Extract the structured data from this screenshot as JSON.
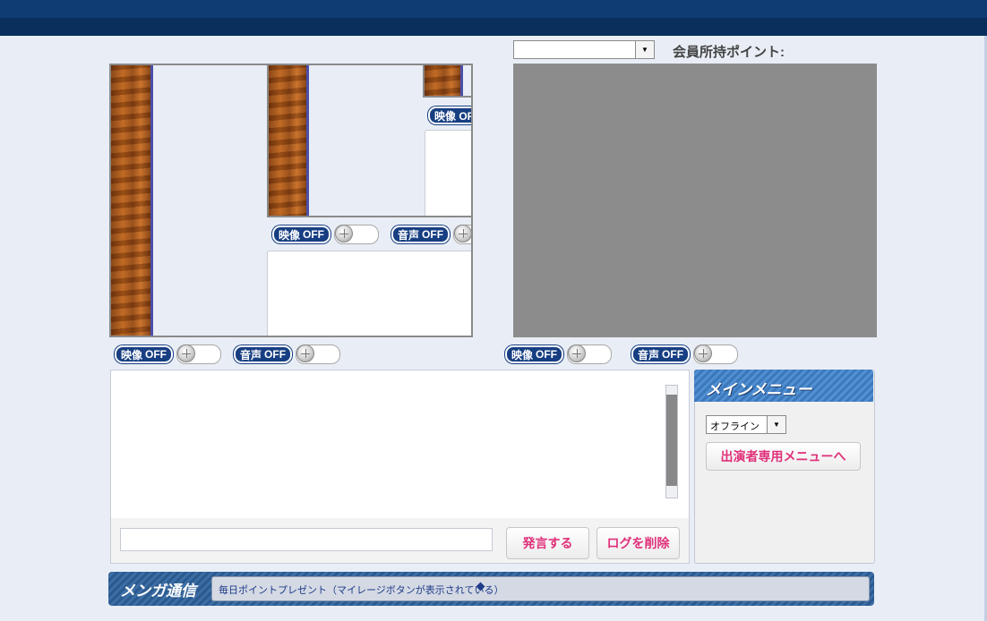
{
  "points": {
    "label": "会員所持ポイント:",
    "select_value": ""
  },
  "controls": {
    "video_label": "映像",
    "audio_label": "音声",
    "state": "OFF",
    "partial_video": "映像 OF"
  },
  "chat": {
    "send_button": "発言する",
    "clear_log_button": "ログを削除",
    "input_value": ""
  },
  "main_menu": {
    "title": "メインメニュー",
    "status_select": "オフライン",
    "performer_menu_button": "出演者専用メニューへ"
  },
  "news": {
    "title": "メンガ通信",
    "text": "毎日ポイントプレゼント（マイレージボタンが表示されている）"
  },
  "colors": {
    "topbar": "#0f3c72",
    "accent_pink": "#e0307a",
    "pill_blue": "#173e82",
    "video_gray": "#8c8c8c"
  }
}
